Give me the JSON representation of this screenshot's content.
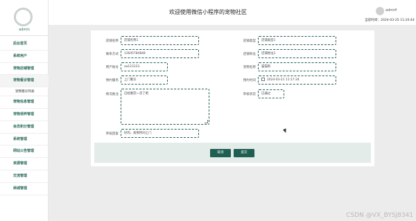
{
  "sidebar": {
    "admin_label": "admin",
    "items": [
      {
        "label": "后台首页",
        "type": "main"
      },
      {
        "label": "系统用户",
        "type": "main"
      },
      {
        "label": "宠物店铺管理",
        "type": "main"
      },
      {
        "label": "宠物看诊管理",
        "type": "main"
      },
      {
        "label": "宠物看诊列表",
        "type": "sub"
      },
      {
        "label": "宠物信息管理",
        "type": "main"
      },
      {
        "label": "宠物领养管理",
        "type": "main"
      },
      {
        "label": "会员积分管理",
        "type": "main"
      },
      {
        "label": "系统管理",
        "type": "main"
      },
      {
        "label": "网站公告管理",
        "type": "main"
      },
      {
        "label": "资源管理",
        "type": "main"
      },
      {
        "label": "交流管理",
        "type": "main"
      },
      {
        "label": "商城管理",
        "type": "main"
      }
    ]
  },
  "header": {
    "title": "欢迎使用微信小程序的宠物社区",
    "user_name": "admin",
    "login_time": "当前时间：2024-03-25 11:20:44"
  },
  "form": {
    "store_name": {
      "label": "店铺名称",
      "value": "店铺名称1"
    },
    "store_type": {
      "label": "店铺类型",
      "value": "店铺类型1"
    },
    "contact": {
      "label": "联系方式",
      "value": "13645784848"
    },
    "store_address": {
      "label": "店铺地址",
      "value": "店铺地址1"
    },
    "user_account": {
      "label": "用户账号",
      "value": "aa123123"
    },
    "pet_name": {
      "label": "宠物名称",
      "value": "猫猫狗"
    },
    "visit_method": {
      "label": "预约服务",
      "value": "上门看诊"
    },
    "visit_time": {
      "label": "预约时间",
      "value": "2024-03-21 11:17:34"
    },
    "notes": {
      "label": "情况备注",
      "value": "已经看完一次了吧"
    },
    "review_status": {
      "label": "审核状态",
      "value": "已通过"
    },
    "reply": {
      "label": "审核回复",
      "value": "好的，按照时间上门"
    }
  },
  "actions": {
    "cancel": "取消",
    "submit": "提交"
  },
  "watermark": "CSDN @VX_BYSJ8341"
}
